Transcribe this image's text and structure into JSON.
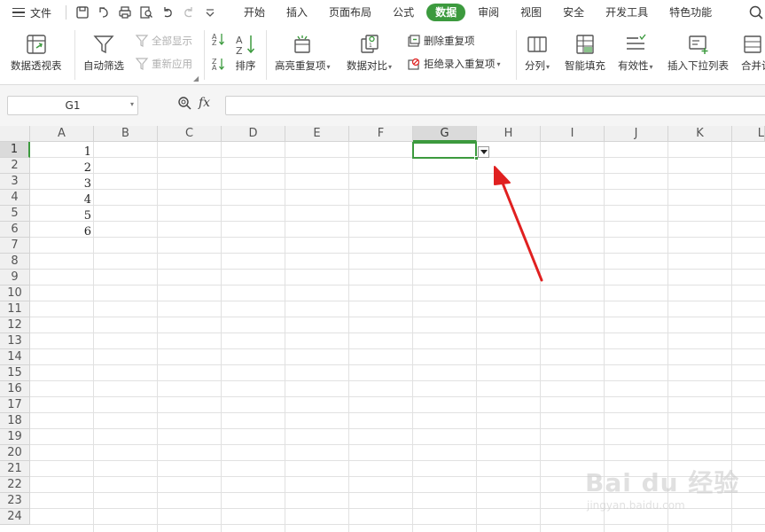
{
  "menu": {
    "file_label": "文件",
    "tabs": [
      "开始",
      "插入",
      "页面布局",
      "公式",
      "数据",
      "审阅",
      "视图",
      "安全",
      "开发工具",
      "特色功能"
    ],
    "active_tab": "数据"
  },
  "ribbon": {
    "pivot": "数据透视表",
    "autofilter": "自动筛选",
    "show_all": "全部显示",
    "reapply": "重新应用",
    "sort": "排序",
    "highlight_dup": "高亮重复项",
    "data_compare": "数据对比",
    "delete_dup": "删除重复项",
    "reject_dup": "拒绝录入重复项",
    "split": "分列",
    "smart_fill": "智能填充",
    "validity": "有效性",
    "insert_dropdown": "插入下拉列表",
    "merge": "合并计"
  },
  "formula_bar": {
    "cell_ref": "G1",
    "fx": "fx",
    "value": ""
  },
  "sheet": {
    "columns": [
      "A",
      "B",
      "C",
      "D",
      "E",
      "F",
      "G",
      "H",
      "I",
      "J",
      "K",
      "L"
    ],
    "rows": [
      "1",
      "2",
      "3",
      "4",
      "5",
      "6",
      "7",
      "8",
      "9",
      "10",
      "11",
      "12",
      "13",
      "14",
      "15",
      "16",
      "17",
      "18",
      "19",
      "20",
      "21",
      "22",
      "23",
      "24"
    ],
    "column_a_values": [
      "1",
      "2",
      "3",
      "4",
      "5",
      "6"
    ],
    "selected_cell": "G1"
  },
  "watermark": {
    "main": "Bai du 经验",
    "sub": "jingyan.baidu.com"
  },
  "colors": {
    "accent": "#3c9a3e",
    "arrow": "#e02020"
  }
}
